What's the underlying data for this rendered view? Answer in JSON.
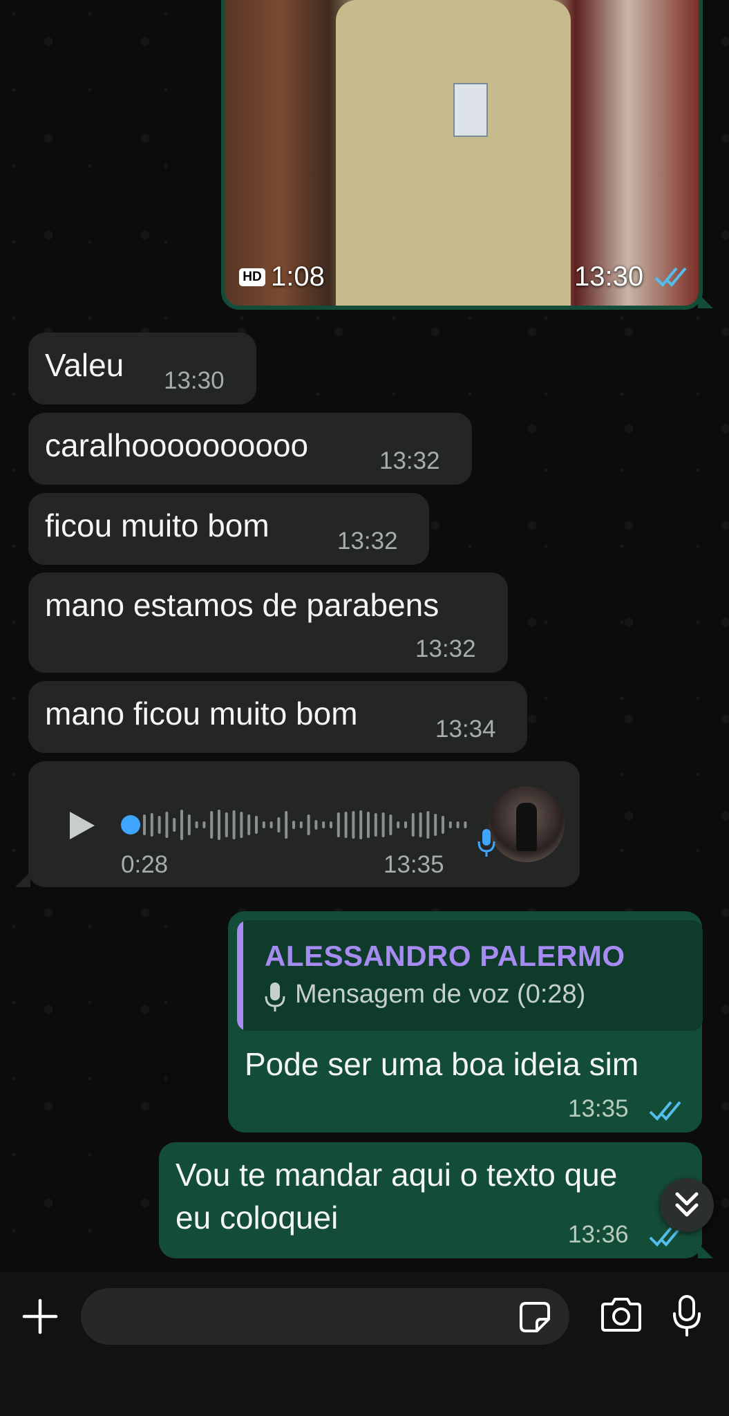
{
  "video": {
    "quality_badge": "HD",
    "duration": "1:08",
    "time": "13:30"
  },
  "incoming": [
    {
      "text": "Valeu",
      "time": "13:30"
    },
    {
      "text": "caralhoooooooooo",
      "time": "13:32"
    },
    {
      "text": "ficou muito bom",
      "time": "13:32"
    },
    {
      "text": "mano estamos de parabens",
      "time": "13:32"
    },
    {
      "text": "mano ficou muito bom",
      "time": "13:34"
    }
  ],
  "voice": {
    "elapsed": "0:28",
    "time": "13:35",
    "progress": 0.0
  },
  "reply": {
    "quote_name": "ALESSANDRO PALERMO",
    "quote_text": "Mensagem de voz (0:28)",
    "text": "Pode ser uma boa ideia sim",
    "time": "13:35"
  },
  "last": {
    "line1": "Vou te mandar aqui o texto que",
    "line2": "eu coloquei",
    "time": "13:36"
  },
  "colors": {
    "outgoing_bubble": "#144d37",
    "incoming_bubble": "#242626",
    "read_ticks": "#53bdeb",
    "quote_accent": "#a68cf2",
    "progress_dot": "#3ea6ff"
  },
  "icons": [
    "plus-icon",
    "sticker-icon",
    "camera-icon",
    "microphone-icon",
    "play-icon",
    "double-chevron-down-icon",
    "hd-badge",
    "double-check-icon"
  ]
}
